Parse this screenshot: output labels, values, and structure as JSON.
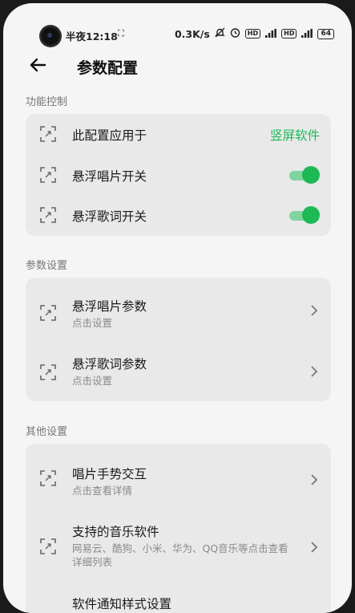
{
  "status_bar": {
    "time": "半夜12:18",
    "scan_glyph": "⛶",
    "speed": "0.3K/s",
    "badge1": "HD",
    "badge2": "4G",
    "badge3": "HD",
    "badge4": "4G",
    "battery": "64"
  },
  "header": {
    "title": "参数配置"
  },
  "sections": {
    "function": {
      "title": "功能控制",
      "items": [
        {
          "label": "此配置应用于",
          "value": "竖屏软件"
        },
        {
          "label": "悬浮唱片开关",
          "toggle_on": true
        },
        {
          "label": "悬浮歌词开关",
          "toggle_on": true
        }
      ]
    },
    "params": {
      "title": "参数设置",
      "items": [
        {
          "label": "悬浮唱片参数",
          "sub": "点击设置"
        },
        {
          "label": "悬浮歌词参数",
          "sub": "点击设置"
        }
      ]
    },
    "other": {
      "title": "其他设置",
      "items": [
        {
          "label": "唱片手势交互",
          "sub": "点击查看详情"
        },
        {
          "label": "支持的音乐软件",
          "sub": "网易云、酷狗、小米、华为、QQ音乐等点击查看详细列表"
        },
        {
          "label": "软件通知样式设置"
        }
      ]
    }
  },
  "colors": {
    "accent": "#1db954",
    "card": "#e9e9e9",
    "background": "#f5f5f5"
  },
  "icons": [
    "back-arrow-icon",
    "scan-frame-icon",
    "chevron-right-icon",
    "toggle-switch"
  ]
}
